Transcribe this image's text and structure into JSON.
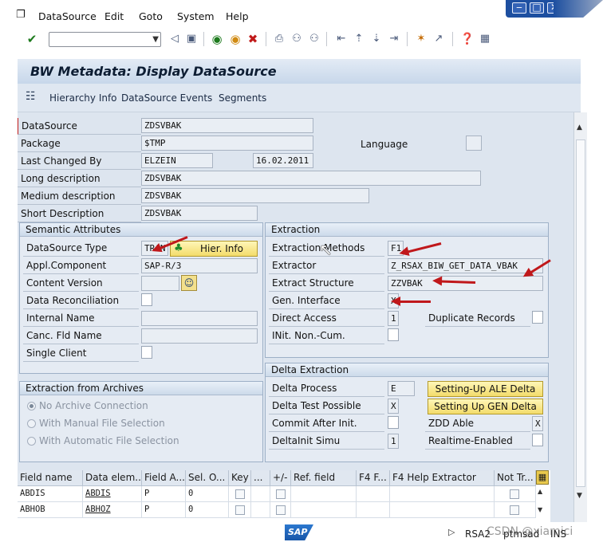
{
  "menu": {
    "items": [
      "DataSource",
      "Edit",
      "Goto",
      "System",
      "Help"
    ]
  },
  "page": {
    "title": "BW Metadata: Display DataSource"
  },
  "app_toolbar": {
    "hierarchy_info": "Hierarchy Info",
    "datasource_events": "DataSource Events",
    "segments": "Segments"
  },
  "header_fields": {
    "datasource": {
      "label": "DataSource",
      "value": "ZDSVBAK"
    },
    "package": {
      "label": "Package",
      "value": "$TMP"
    },
    "language": {
      "label": "Language"
    },
    "last_changed_by": {
      "label": "Last Changed By",
      "value": "ELZEIN",
      "date": "16.02.2011"
    },
    "long_description": {
      "label": "Long description",
      "value": "ZDSVBAK"
    },
    "medium_description": {
      "label": "Medium description",
      "value": "ZDSVBAK"
    },
    "short_description": {
      "label": "Short Description",
      "value": "ZDSVBAK"
    }
  },
  "semantic": {
    "title": "Semantic Attributes",
    "datasource_type": {
      "label": "DataSource Type",
      "value": "TRAN"
    },
    "hier_info_button": "Hier. Info",
    "appl_component": {
      "label": "Appl.Component",
      "value": "SAP-R/3"
    },
    "content_version": {
      "label": "Content Version"
    },
    "data_reconciliation": {
      "label": "Data Reconciliation"
    },
    "internal_name": {
      "label": "Internal Name"
    },
    "canc_fld_name": {
      "label": "Canc. Fld Name"
    },
    "single_client": {
      "label": "Single Client"
    }
  },
  "extraction": {
    "title": "Extraction",
    "methods": {
      "label": "Extraction Methods",
      "value": "F1"
    },
    "extractor": {
      "label": "Extractor",
      "value": "Z_RSAX_BIW_GET_DATA_VBAK"
    },
    "structure": {
      "label": "Extract Structure",
      "value": "ZZVBAK"
    },
    "gen_interface": {
      "label": "Gen. Interface",
      "value": "X"
    },
    "direct_access": {
      "label": "Direct Access",
      "value": "1"
    },
    "duplicate_records": {
      "label": "Duplicate Records"
    },
    "init_non_cum": {
      "label": "INit. Non.-Cum."
    }
  },
  "archives": {
    "title": "Extraction from Archives",
    "options": [
      "No Archive Connection",
      "With Manual File Selection",
      "With Automatic File Selection"
    ],
    "selected_index": 0
  },
  "delta": {
    "title": "Delta Extraction",
    "delta_process": {
      "label": "Delta Process",
      "value": "E"
    },
    "setup_ale": "Setting-Up ALE Delta",
    "delta_test": {
      "label": "Delta Test Possible",
      "value": "X"
    },
    "setup_gen": "Setting Up GEN Delta",
    "commit_after_init": {
      "label": "Commit After Init."
    },
    "zdd_able": {
      "label": "ZDD Able",
      "value": "X"
    },
    "deltainit_simu": {
      "label": "DeltaInit Simu",
      "value": "1"
    },
    "realtime_enabled": {
      "label": "Realtime-Enabled"
    }
  },
  "table": {
    "columns": [
      "Field name",
      "Data elem...",
      "Field A...",
      "Sel. O...",
      "Key",
      "...",
      "+/-",
      "Ref. field",
      "F4 F...",
      "F4 Help Extractor",
      "Not Tr..."
    ],
    "rows": [
      {
        "field": "ABDIS",
        "data_elem": "ABDIS",
        "field_attr": "P",
        "sel": "0"
      },
      {
        "field": "ABHOB",
        "data_elem": "ABHOZ",
        "field_attr": "P",
        "sel": "0"
      }
    ]
  },
  "status": {
    "transaction": "RSA2",
    "server": "ptmsad",
    "mode": "INS",
    "watermark": "CSDN @xiamici"
  },
  "colors": {
    "title_bg": "#c7d7ea",
    "work_bg": "#dde5ef",
    "button_yellow": "#f3dc6b",
    "annotation_red": "#c0181b"
  }
}
